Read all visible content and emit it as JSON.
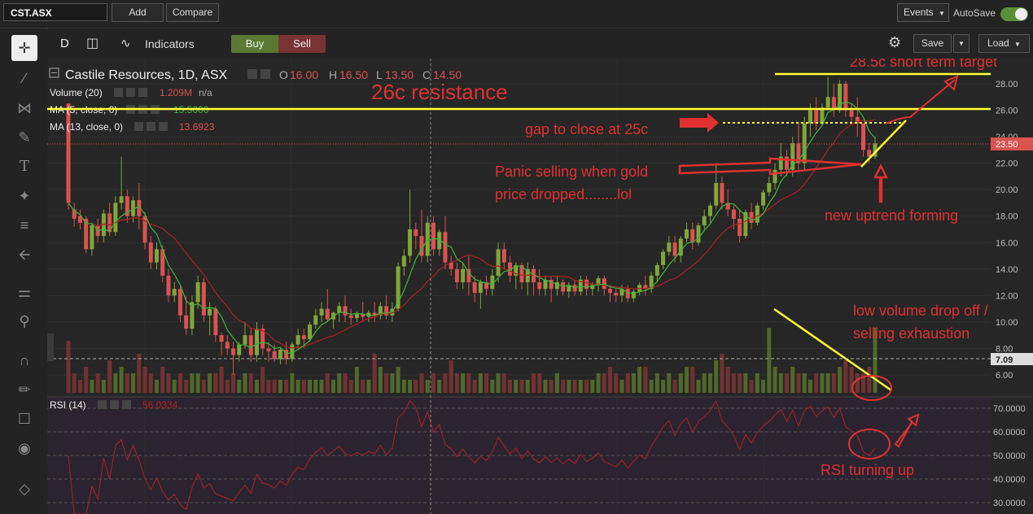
{
  "topbar": {
    "symbol": "CST.ASX",
    "add_label": "Add",
    "compare_label": "Compare",
    "events_label": "Events",
    "autosave_label": "AutoSave"
  },
  "header": {
    "interval": "D",
    "indicators_label": "Indicators",
    "buy_label": "Buy",
    "sell_label": "Sell",
    "save_label": "Save",
    "load_label": "Load"
  },
  "legend": {
    "title": "Castile Resources, 1D, ASX",
    "o_label": "O",
    "o_value": "16.00",
    "h_label": "H",
    "h_value": "16.50",
    "l_label": "L",
    "l_value": "13.50",
    "c_label": "C",
    "c_value": "14.50",
    "volume_label": "Volume (20)",
    "volume_value": "1.209M",
    "volume_value2": "n/a",
    "ma5_label": "MA (5, close, 0)",
    "ma5_value": "15.5000",
    "ma13_label": "MA (13, close, 0)",
    "ma13_value": "13.6923",
    "rsi_label": "RSI (14)",
    "rsi_value": "56.0334"
  },
  "annotations": {
    "resistance": "26c resistance",
    "target": "28.5c short term target",
    "gap": "gap to close at 25c",
    "panic1": "Panic selling when gold",
    "panic2": "price dropped........lol",
    "uptrend": "new uptrend forming",
    "lowvol1": "low volume drop off /",
    "lowvol2": "selling exhaustion",
    "rsi": "RSI turning up"
  },
  "colors": {
    "up": "#7fa63a",
    "down": "#d9534f",
    "annotation": "#e03030",
    "trendline": "#ffff33",
    "ma5": "#3cb83c",
    "ma13": "#b02020",
    "rsi_line": "#b02020",
    "price_badge": "#d9534f"
  },
  "chart_data": {
    "type": "candlestick",
    "price_axis": {
      "ticks": [
        "28.00",
        "26.00",
        "24.00",
        "22.00",
        "20.00",
        "18.00",
        "16.00",
        "14.00",
        "12.00",
        "10.00",
        "8.00",
        "6.00"
      ],
      "ylim": [
        5,
        29
      ],
      "current_price": "23.50",
      "volume_marker": "7.09"
    },
    "rsi_axis": {
      "ticks": [
        "70.0000",
        "60.0000",
        "50.0000",
        "40.0000",
        "30.0000"
      ],
      "ylim": [
        25,
        75
      ]
    },
    "candles": [
      {
        "o": 26.5,
        "h": 26.5,
        "c": 19.0,
        "l": 18.5
      },
      {
        "o": 18.5,
        "h": 19.0,
        "c": 17.8,
        "l": 17.2
      },
      {
        "o": 18.0,
        "h": 18.5,
        "c": 17.5,
        "l": 17.0
      },
      {
        "o": 17.8,
        "h": 18.0,
        "c": 15.5,
        "l": 15.2
      },
      {
        "o": 15.5,
        "h": 17.5,
        "c": 17.3,
        "l": 15.0
      },
      {
        "o": 17.3,
        "h": 17.8,
        "c": 16.5,
        "l": 16.0
      },
      {
        "o": 16.5,
        "h": 18.5,
        "c": 18.2,
        "l": 16.0
      },
      {
        "o": 18.2,
        "h": 19.0,
        "c": 16.8,
        "l": 16.5
      },
      {
        "o": 16.8,
        "h": 19.5,
        "c": 19.0,
        "l": 16.5
      },
      {
        "o": 19.0,
        "h": 22.5,
        "c": 19.5,
        "l": 18.5
      },
      {
        "o": 19.5,
        "h": 20.0,
        "c": 18.0,
        "l": 17.5
      },
      {
        "o": 18.0,
        "h": 19.5,
        "c": 19.2,
        "l": 17.5
      },
      {
        "o": 19.2,
        "h": 20.5,
        "c": 18.0,
        "l": 17.0
      },
      {
        "o": 18.0,
        "h": 18.3,
        "c": 16.0,
        "l": 15.5
      },
      {
        "o": 16.0,
        "h": 16.5,
        "c": 14.5,
        "l": 14.0
      },
      {
        "o": 14.5,
        "h": 16.0,
        "c": 15.5,
        "l": 14.0
      },
      {
        "o": 15.5,
        "h": 15.8,
        "c": 13.5,
        "l": 13.0
      },
      {
        "o": 13.5,
        "h": 14.0,
        "c": 12.0,
        "l": 11.5
      },
      {
        "o": 12.0,
        "h": 13.0,
        "c": 12.5,
        "l": 11.5
      },
      {
        "o": 12.5,
        "h": 12.7,
        "c": 10.5,
        "l": 10.0
      },
      {
        "o": 10.5,
        "h": 12.0,
        "c": 9.5,
        "l": 9.0
      },
      {
        "o": 9.5,
        "h": 12.0,
        "c": 11.5,
        "l": 9.0
      },
      {
        "o": 11.5,
        "h": 13.5,
        "c": 13.0,
        "l": 11.0
      },
      {
        "o": 13.0,
        "h": 13.3,
        "c": 10.5,
        "l": 10.0
      },
      {
        "o": 10.5,
        "h": 11.5,
        "c": 11.0,
        "l": 9.0
      },
      {
        "o": 11.0,
        "h": 11.2,
        "c": 9.0,
        "l": 8.5
      },
      {
        "o": 9.0,
        "h": 9.2,
        "c": 8.5,
        "l": 7.5
      },
      {
        "o": 8.5,
        "h": 9.0,
        "c": 8.0,
        "l": 7.5
      },
      {
        "o": 8.0,
        "h": 8.5,
        "c": 7.5,
        "l": 6.0
      },
      {
        "o": 7.5,
        "h": 8.5,
        "c": 8.3,
        "l": 7.0
      },
      {
        "o": 8.3,
        "h": 10.0,
        "c": 9.0,
        "l": 8.0
      },
      {
        "o": 9.0,
        "h": 9.5,
        "c": 7.5,
        "l": 7.0
      },
      {
        "o": 7.5,
        "h": 10.0,
        "c": 9.5,
        "l": 7.0
      },
      {
        "o": 9.5,
        "h": 9.8,
        "c": 8.0,
        "l": 7.5
      },
      {
        "o": 8.0,
        "h": 8.5,
        "c": 7.8,
        "l": 7.0
      },
      {
        "o": 7.8,
        "h": 8.3,
        "c": 7.2,
        "l": 7.0
      },
      {
        "o": 7.2,
        "h": 8.0,
        "c": 7.9,
        "l": 6.8
      },
      {
        "o": 7.9,
        "h": 8.5,
        "c": 7.2,
        "l": 6.8
      },
      {
        "o": 7.2,
        "h": 8.5,
        "c": 8.3,
        "l": 7.0
      },
      {
        "o": 8.3,
        "h": 9.5,
        "c": 9.0,
        "l": 8.0
      },
      {
        "o": 9.0,
        "h": 9.5,
        "c": 8.7,
        "l": 8.0
      },
      {
        "o": 8.7,
        "h": 10.0,
        "c": 9.8,
        "l": 8.5
      },
      {
        "o": 9.8,
        "h": 11.0,
        "c": 10.5,
        "l": 9.5
      },
      {
        "o": 10.5,
        "h": 11.5,
        "c": 11.0,
        "l": 10.0
      },
      {
        "o": 11.0,
        "h": 12.5,
        "c": 10.2,
        "l": 10.0
      },
      {
        "o": 10.2,
        "h": 10.8,
        "c": 10.7,
        "l": 9.5
      },
      {
        "o": 10.7,
        "h": 11.5,
        "c": 11.2,
        "l": 10.0
      },
      {
        "o": 11.2,
        "h": 12.0,
        "c": 10.5,
        "l": 10.0
      },
      {
        "o": 10.5,
        "h": 11.0,
        "c": 10.3,
        "l": 9.8
      },
      {
        "o": 10.3,
        "h": 10.8,
        "c": 10.6,
        "l": 10.0
      },
      {
        "o": 10.6,
        "h": 11.5,
        "c": 10.4,
        "l": 10.0
      },
      {
        "o": 10.4,
        "h": 10.9,
        "c": 10.7,
        "l": 10.0
      },
      {
        "o": 10.7,
        "h": 11.5,
        "c": 10.5,
        "l": 10.0
      },
      {
        "o": 10.5,
        "h": 11.5,
        "c": 11.2,
        "l": 10.2
      },
      {
        "o": 11.2,
        "h": 12.0,
        "c": 10.5,
        "l": 10.2
      },
      {
        "o": 10.5,
        "h": 11.5,
        "c": 11.0,
        "l": 10.0
      },
      {
        "o": 11.0,
        "h": 14.5,
        "c": 14.2,
        "l": 10.8
      },
      {
        "o": 14.2,
        "h": 15.5,
        "c": 15.0,
        "l": 13.5
      },
      {
        "o": 15.0,
        "h": 20.0,
        "c": 17.0,
        "l": 14.5
      },
      {
        "o": 17.0,
        "h": 17.5,
        "c": 16.5,
        "l": 15.5
      },
      {
        "o": 16.5,
        "h": 18.5,
        "c": 15.0,
        "l": 14.5
      },
      {
        "o": 15.0,
        "h": 18.0,
        "c": 17.5,
        "l": 14.5
      },
      {
        "o": 17.5,
        "h": 18.0,
        "c": 15.5,
        "l": 15.0
      },
      {
        "o": 15.5,
        "h": 17.0,
        "c": 16.8,
        "l": 15.0
      },
      {
        "o": 16.8,
        "h": 18.0,
        "c": 14.5,
        "l": 14.0
      },
      {
        "o": 14.5,
        "h": 15.0,
        "c": 14.0,
        "l": 13.5
      },
      {
        "o": 14.0,
        "h": 14.5,
        "c": 13.0,
        "l": 12.5
      },
      {
        "o": 13.0,
        "h": 14.5,
        "c": 14.0,
        "l": 12.5
      },
      {
        "o": 14.0,
        "h": 15.0,
        "c": 13.0,
        "l": 12.0
      },
      {
        "o": 13.0,
        "h": 13.5,
        "c": 12.2,
        "l": 11.5
      },
      {
        "o": 12.2,
        "h": 13.2,
        "c": 13.0,
        "l": 11.0
      },
      {
        "o": 13.0,
        "h": 13.5,
        "c": 12.5,
        "l": 12.0
      },
      {
        "o": 12.5,
        "h": 14.0,
        "c": 13.5,
        "l": 12.0
      },
      {
        "o": 13.5,
        "h": 16.0,
        "c": 15.5,
        "l": 13.0
      },
      {
        "o": 15.5,
        "h": 16.0,
        "c": 14.5,
        "l": 14.0
      },
      {
        "o": 14.5,
        "h": 15.0,
        "c": 13.5,
        "l": 13.0
      },
      {
        "o": 13.5,
        "h": 14.5,
        "c": 14.3,
        "l": 12.5
      },
      {
        "o": 14.3,
        "h": 14.5,
        "c": 13.0,
        "l": 12.5
      },
      {
        "o": 13.0,
        "h": 14.5,
        "c": 14.0,
        "l": 12.0
      },
      {
        "o": 14.0,
        "h": 14.3,
        "c": 13.0,
        "l": 12.0
      },
      {
        "o": 13.0,
        "h": 14.0,
        "c": 12.5,
        "l": 12.0
      },
      {
        "o": 12.5,
        "h": 13.5,
        "c": 13.2,
        "l": 12.0
      },
      {
        "o": 13.2,
        "h": 13.5,
        "c": 12.5,
        "l": 11.5
      },
      {
        "o": 12.5,
        "h": 13.5,
        "c": 13.0,
        "l": 12.0
      },
      {
        "o": 13.0,
        "h": 13.2,
        "c": 12.3,
        "l": 12.0
      },
      {
        "o": 12.3,
        "h": 13.0,
        "c": 12.8,
        "l": 11.8
      },
      {
        "o": 12.8,
        "h": 13.2,
        "c": 12.3,
        "l": 12.0
      },
      {
        "o": 12.3,
        "h": 13.5,
        "c": 13.2,
        "l": 12.0
      },
      {
        "o": 13.2,
        "h": 13.5,
        "c": 12.5,
        "l": 12.0
      },
      {
        "o": 12.5,
        "h": 13.0,
        "c": 12.8,
        "l": 12.0
      },
      {
        "o": 12.8,
        "h": 13.5,
        "c": 13.3,
        "l": 12.3
      },
      {
        "o": 13.3,
        "h": 13.5,
        "c": 12.5,
        "l": 12.0
      },
      {
        "o": 12.5,
        "h": 12.8,
        "c": 12.2,
        "l": 11.5
      },
      {
        "o": 12.2,
        "h": 12.5,
        "c": 12.0,
        "l": 11.5
      },
      {
        "o": 12.0,
        "h": 12.8,
        "c": 12.5,
        "l": 11.5
      },
      {
        "o": 12.5,
        "h": 12.8,
        "c": 11.8,
        "l": 11.5
      },
      {
        "o": 11.8,
        "h": 12.5,
        "c": 12.3,
        "l": 11.5
      },
      {
        "o": 12.3,
        "h": 13.0,
        "c": 12.8,
        "l": 12.0
      },
      {
        "o": 12.8,
        "h": 13.5,
        "c": 12.5,
        "l": 12.0
      },
      {
        "o": 12.5,
        "h": 13.8,
        "c": 13.5,
        "l": 12.2
      },
      {
        "o": 13.5,
        "h": 14.5,
        "c": 14.3,
        "l": 13.0
      },
      {
        "o": 14.3,
        "h": 15.5,
        "c": 15.3,
        "l": 14.0
      },
      {
        "o": 15.3,
        "h": 16.5,
        "c": 16.0,
        "l": 15.0
      },
      {
        "o": 16.0,
        "h": 16.5,
        "c": 15.0,
        "l": 14.5
      },
      {
        "o": 15.0,
        "h": 16.5,
        "c": 16.3,
        "l": 14.5
      },
      {
        "o": 16.3,
        "h": 17.5,
        "c": 17.0,
        "l": 16.0
      },
      {
        "o": 17.0,
        "h": 17.5,
        "c": 16.0,
        "l": 15.5
      },
      {
        "o": 16.0,
        "h": 17.5,
        "c": 17.3,
        "l": 15.8
      },
      {
        "o": 17.3,
        "h": 18.5,
        "c": 18.0,
        "l": 17.0
      },
      {
        "o": 18.0,
        "h": 19.0,
        "c": 18.8,
        "l": 17.5
      },
      {
        "o": 18.8,
        "h": 22.0,
        "c": 20.5,
        "l": 18.5
      },
      {
        "o": 20.5,
        "h": 21.0,
        "c": 19.0,
        "l": 18.5
      },
      {
        "o": 19.0,
        "h": 20.0,
        "c": 18.5,
        "l": 18.0
      },
      {
        "o": 18.5,
        "h": 18.8,
        "c": 17.8,
        "l": 17.0
      },
      {
        "o": 17.8,
        "h": 18.5,
        "c": 16.5,
        "l": 16.0
      },
      {
        "o": 16.5,
        "h": 18.5,
        "c": 18.3,
        "l": 16.3
      },
      {
        "o": 18.3,
        "h": 19.0,
        "c": 17.5,
        "l": 17.0
      },
      {
        "o": 17.5,
        "h": 19.0,
        "c": 18.8,
        "l": 17.3
      },
      {
        "o": 18.8,
        "h": 20.0,
        "c": 19.8,
        "l": 18.5
      },
      {
        "o": 19.8,
        "h": 21.0,
        "c": 20.5,
        "l": 19.5
      },
      {
        "o": 20.5,
        "h": 22.0,
        "c": 21.5,
        "l": 20.0
      },
      {
        "o": 21.5,
        "h": 23.5,
        "c": 22.5,
        "l": 21.0
      },
      {
        "o": 22.5,
        "h": 23.0,
        "c": 21.5,
        "l": 21.0
      },
      {
        "o": 21.5,
        "h": 24.0,
        "c": 23.5,
        "l": 21.0
      },
      {
        "o": 23.5,
        "h": 25.0,
        "c": 22.0,
        "l": 21.5
      },
      {
        "o": 22.0,
        "h": 25.5,
        "c": 25.0,
        "l": 21.5
      },
      {
        "o": 25.0,
        "h": 26.5,
        "c": 26.0,
        "l": 24.0
      },
      {
        "o": 26.0,
        "h": 27.0,
        "c": 25.0,
        "l": 24.5
      },
      {
        "o": 25.0,
        "h": 26.5,
        "c": 26.2,
        "l": 24.8
      },
      {
        "o": 26.2,
        "h": 28.5,
        "c": 27.0,
        "l": 26.0
      },
      {
        "o": 27.0,
        "h": 28.0,
        "c": 26.0,
        "l": 25.5
      },
      {
        "o": 26.0,
        "h": 28.3,
        "c": 28.0,
        "l": 25.8
      },
      {
        "o": 28.0,
        "h": 28.2,
        "c": 26.0,
        "l": 25.5
      },
      {
        "o": 26.0,
        "h": 26.5,
        "c": 25.5,
        "l": 25.0
      },
      {
        "o": 25.5,
        "h": 27.0,
        "c": 25.0,
        "l": 24.0
      },
      {
        "o": 25.0,
        "h": 25.0,
        "c": 23.0,
        "l": 22.5
      },
      {
        "o": 23.0,
        "h": 23.5,
        "c": 22.5,
        "l": 22.0
      },
      {
        "o": 22.5,
        "h": 24.0,
        "c": 23.5,
        "l": 22.3
      }
    ],
    "volume": [
      8,
      3,
      2,
      4,
      2,
      3,
      2,
      5,
      3,
      4,
      3,
      3,
      6,
      4,
      3,
      2,
      4,
      3,
      2,
      3,
      2,
      3,
      3,
      2,
      3,
      3,
      4,
      2,
      3,
      2,
      3,
      3,
      2,
      4,
      2,
      2,
      2,
      2,
      3,
      2,
      2,
      2,
      2,
      2,
      3,
      2,
      3,
      3,
      2,
      4,
      2,
      2,
      6,
      4,
      3,
      3,
      4,
      2,
      2,
      2,
      3,
      2,
      3,
      2,
      3,
      5,
      3,
      3,
      3,
      2,
      3,
      3,
      2,
      3,
      3,
      2,
      2,
      2,
      2,
      3,
      3,
      2,
      2,
      3,
      2,
      2,
      2,
      2,
      2,
      2,
      3,
      3,
      4,
      3,
      2,
      3,
      3,
      4,
      4,
      2,
      3,
      2,
      3,
      2,
      3,
      4,
      4,
      2,
      3,
      3,
      5,
      6,
      4,
      3,
      3,
      3,
      2,
      3,
      2,
      10,
      4,
      3,
      3,
      4,
      3,
      3,
      2,
      3,
      3,
      3,
      3,
      4,
      5,
      4,
      3,
      3,
      4,
      10,
      5,
      4,
      3,
      3,
      3,
      2,
      3,
      2,
      2
    ]
  }
}
